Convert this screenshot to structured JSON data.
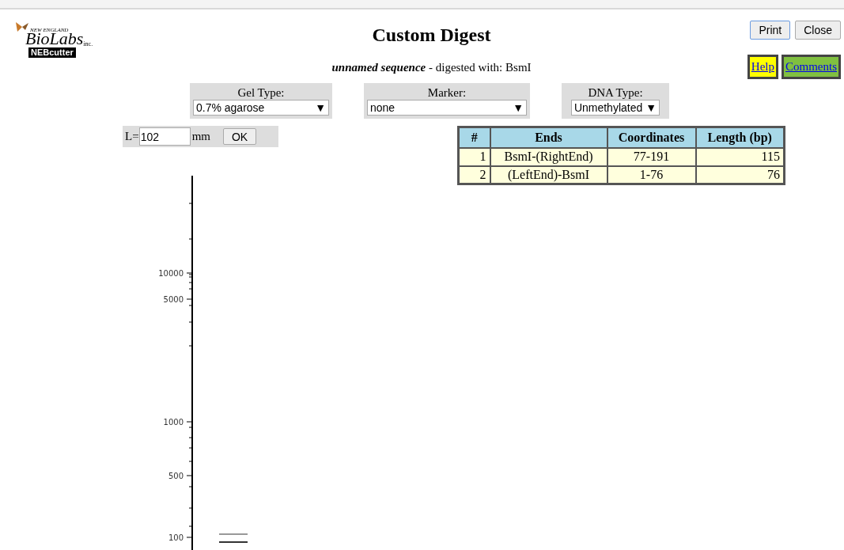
{
  "logo": {
    "top": "NEW ENGLAND",
    "main": "BioLabs",
    "suffix": "inc.",
    "badge": "NEBcutter"
  },
  "title": "Custom Digest",
  "subtitle": {
    "name": "unnamed sequence",
    "rest": " - digested with: BsmI"
  },
  "buttons": [
    "Print",
    "Close"
  ],
  "links": [
    {
      "label": "Help",
      "color": "#ffff00"
    },
    {
      "label": "Comments",
      "color": "#80c040"
    }
  ],
  "selects": [
    {
      "label": "Gel Type:",
      "value": "0.7% agarose",
      "arrow": "▼"
    },
    {
      "label": "Marker:",
      "value": "none",
      "arrow": "▼"
    },
    {
      "label": "DNA Type:",
      "value": "Unmethylated",
      "arrow": "▼"
    }
  ],
  "length": {
    "prefix": "L=",
    "value": "102",
    "unit": "mm",
    "button": "OK"
  },
  "table": {
    "columns": [
      "#",
      "Ends",
      "Coordinates",
      "Length (bp)"
    ],
    "rows": [
      [
        "1",
        "BsmI-(RightEnd)",
        "77-191",
        "115"
      ],
      [
        "2",
        "(LeftEnd)-BsmI",
        "1-76",
        "76"
      ]
    ]
  },
  "gel": {
    "tick_labels": [
      "10000",
      "5000",
      "1000",
      "500",
      "100"
    ]
  }
}
